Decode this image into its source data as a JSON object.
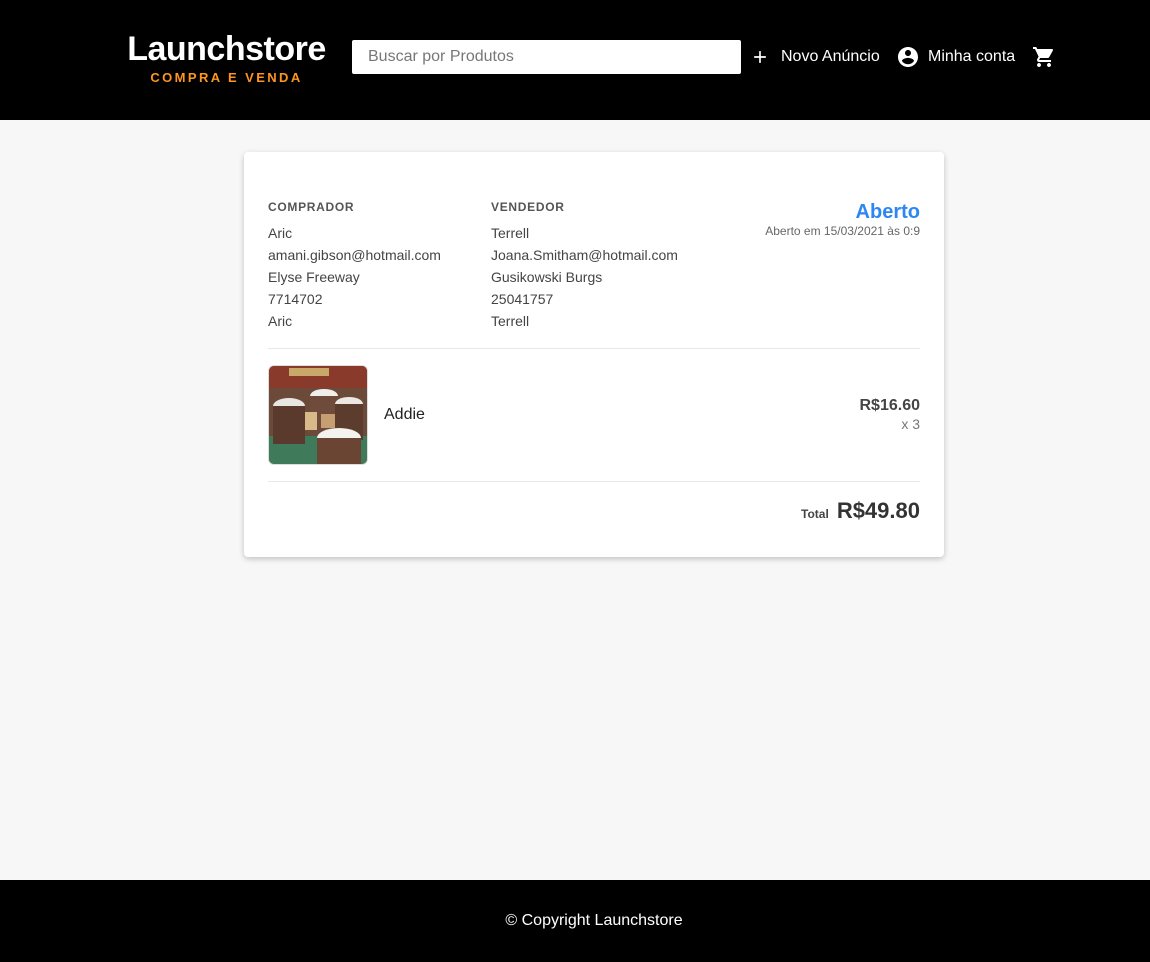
{
  "header": {
    "logo_title": "Launchstore",
    "logo_subtitle": "COMPRA E VENDA",
    "search_placeholder": "Buscar por Produtos",
    "nav_new_ad": "Novo Anúncio",
    "nav_account": "Minha conta",
    "icons": {
      "new_ad": "plus-icon",
      "account": "account-circle-icon",
      "cart": "shopping-cart-icon"
    },
    "accent_color": "#fd951f"
  },
  "order": {
    "buyer": {
      "heading": "COMPRADOR",
      "name": "Aric",
      "email": "amani.gibson@hotmail.com",
      "address": "Elyse Freeway",
      "cep": "7714702",
      "extra": "Aric"
    },
    "seller": {
      "heading": "VENDEDOR",
      "name": "Terrell",
      "email": "Joana.Smitham@hotmail.com",
      "address": "Gusikowski Burgs",
      "cep": "25041757",
      "extra": "Terrell"
    },
    "status": {
      "label": "Aberto",
      "date": "Aberto em 15/03/2021 às 0:9",
      "color": "#2c87f2"
    },
    "item": {
      "name": "Addie",
      "price": "R$16.60",
      "quantity": "x 3",
      "image": "product-photo"
    },
    "total_label": "Total",
    "total_value": "R$49.80"
  },
  "footer": {
    "copyright": "© Copyright Launchstore"
  }
}
